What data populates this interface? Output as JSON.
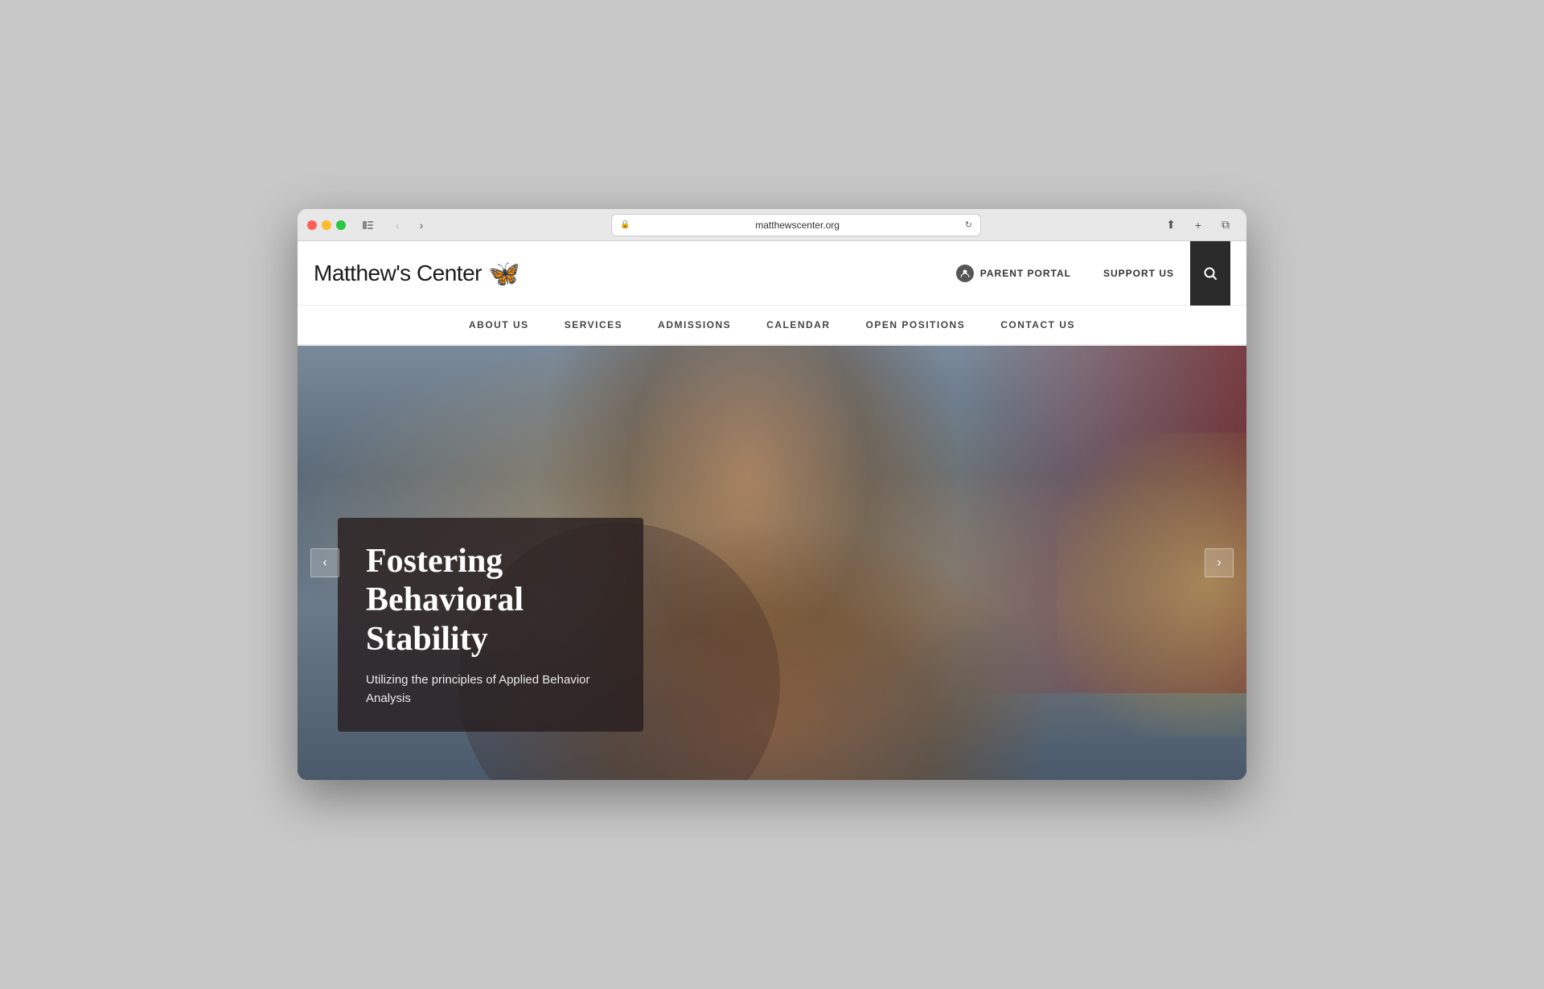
{
  "browser": {
    "url": "matthewscenter.org",
    "back_disabled": true,
    "forward_disabled": false
  },
  "site": {
    "title": "Matthew's Center",
    "url": "matthewscenter.org"
  },
  "header": {
    "logo_text": "Matthew's Center",
    "butterfly_emoji": "🦋",
    "parent_portal_label": "PARENT PORTAL",
    "support_us_label": "SUPPORT US",
    "search_aria": "Search"
  },
  "nav": {
    "items": [
      {
        "label": "ABOUT US",
        "id": "about-us"
      },
      {
        "label": "SERVICES",
        "id": "services"
      },
      {
        "label": "ADMISSIONS",
        "id": "admissions"
      },
      {
        "label": "CALENDAR",
        "id": "calendar"
      },
      {
        "label": "OPEN POSITIONS",
        "id": "open-positions"
      },
      {
        "label": "CONTACT US",
        "id": "contact-us"
      }
    ]
  },
  "hero": {
    "title": "Fostering Behavioral Stability",
    "subtitle": "Utilizing the principles of Applied Behavior Analysis",
    "prev_arrow": "‹",
    "next_arrow": "›"
  },
  "colors": {
    "dark_header_bg": "#2a2a2a",
    "overlay_bg": "rgba(40,30,30,0.82)",
    "accent_brown": "#92400e"
  }
}
